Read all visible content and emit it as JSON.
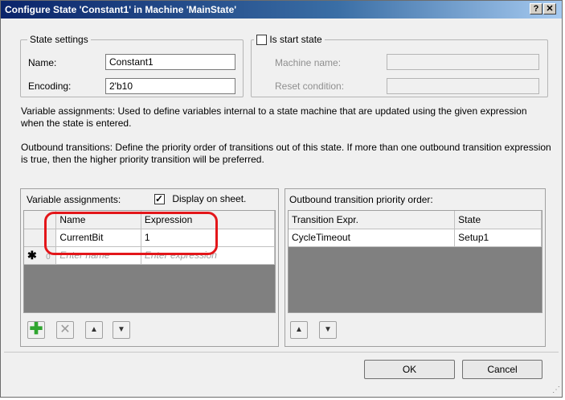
{
  "window": {
    "title": "Configure State 'Constant1' in Machine 'MainState'",
    "help_btn": "?",
    "close_btn": "✕"
  },
  "state_settings": {
    "legend": "State settings",
    "name_label": "Name:",
    "name_value": "Constant1",
    "encoding_label": "Encoding:",
    "encoding_value": "2'b10"
  },
  "start_state": {
    "legend": "Is start state",
    "checked": false,
    "machine_name_label": "Machine name:",
    "machine_name_value": "",
    "reset_condition_label": "Reset condition:",
    "reset_condition_value": ""
  },
  "descriptions": {
    "variable": "Variable assignments: Used to define variables internal to a state machine that are updated using the given expression when the state is entered.",
    "outbound": "Outbound transitions: Define the priority order of transitions out of this state. If more than one outbound transition expression is true, then the higher priority transition will be preferred."
  },
  "variables_panel": {
    "label": "Variable assignments:",
    "display_on_sheet_label": "Display on sheet.",
    "display_on_sheet_checked": true,
    "check_mark": "✓",
    "columns": [
      "Name",
      "Expression"
    ],
    "rows": [
      {
        "name": "CurrentBit",
        "expression": "1"
      }
    ],
    "new_row": {
      "marker": "✱",
      "index": "0",
      "name_placeholder": "Enter name",
      "expression_placeholder": "Enter expression"
    }
  },
  "transitions_panel": {
    "label": "Outbound transition priority order:",
    "columns": [
      "Transition Expr.",
      "State"
    ],
    "rows": [
      {
        "expr": "CycleTimeout",
        "state": "Setup1"
      }
    ]
  },
  "toolbar_icons": {
    "add": "✚",
    "delete": "✕",
    "up": "▲",
    "down": "▼"
  },
  "buttons": {
    "ok": "OK",
    "cancel": "Cancel"
  },
  "colors": {
    "highlight": "#e3161a",
    "add_icon": "#2fa52f"
  }
}
